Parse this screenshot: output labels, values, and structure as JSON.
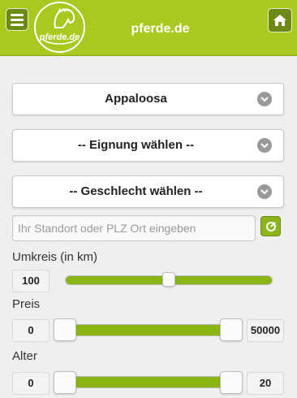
{
  "header": {
    "title": "pferde.de",
    "logo_text": "pferde.de",
    "menu_icon": "menu-icon",
    "home_icon": "home-icon",
    "brand_color": "#a9c820"
  },
  "filters": {
    "breed": {
      "value": "Appaloosa",
      "icon": "chevron-down-icon"
    },
    "suitability": {
      "value": "-- Eignung wählen --",
      "icon": "chevron-down-icon"
    },
    "gender": {
      "value": "-- Geschlecht wählen --",
      "icon": "chevron-down-icon"
    }
  },
  "location": {
    "placeholder": "Ihr Standort oder PLZ Ort eingeben",
    "locate_icon": "locate-icon"
  },
  "radius": {
    "label": "Umkreis (in km)",
    "value": "100",
    "slider_fraction": 0.5
  },
  "price": {
    "label": "Preis",
    "min": "0",
    "max": "50000",
    "range_min_fraction": 0.0,
    "range_max_fraction": 1.0
  },
  "age": {
    "label": "Alter",
    "min": "0",
    "max": "20",
    "range_min_fraction": 0.0,
    "range_max_fraction": 1.0
  }
}
